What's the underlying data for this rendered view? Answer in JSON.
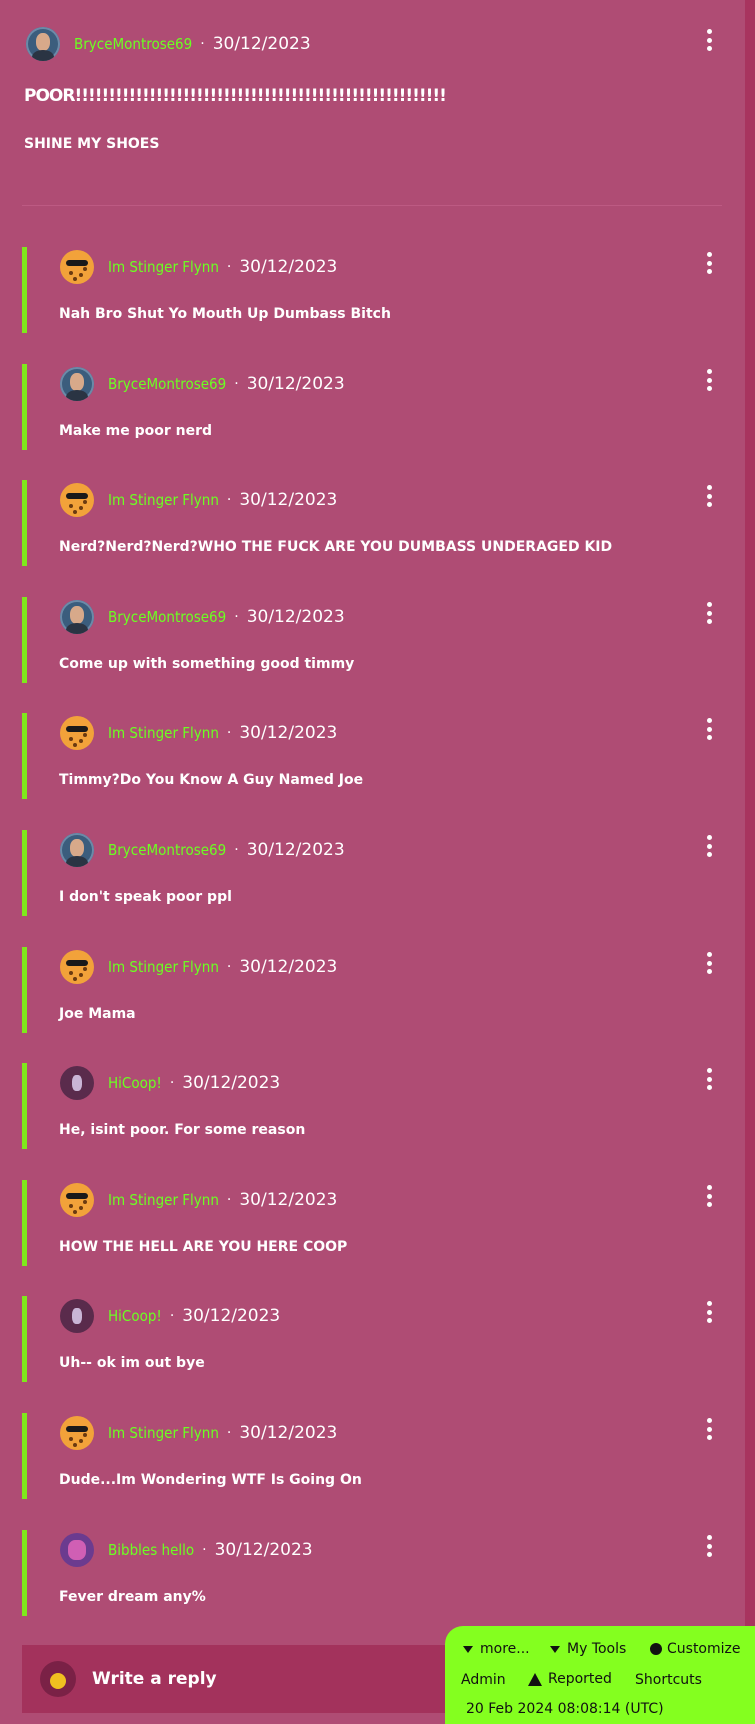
{
  "post": {
    "author": "BryceMontrose69",
    "date": "30/12/2023",
    "title": "POOR!!!!!!!!!!!!!!!!!!!!!!!!!!!!!!!!!!!!!!!!!!!!!!!!!!!!!!!",
    "body": "SHINE MY SHOES"
  },
  "separator": "·",
  "replies": [
    {
      "author": "Im Stinger Flynn",
      "avatar": "flynn",
      "date": "30/12/2023",
      "text": "Nah Bro Shut Yo Mouth Up Dumbass Bitch"
    },
    {
      "author": "BryceMontrose69",
      "avatar": "bryce",
      "date": "30/12/2023",
      "text": "Make me poor nerd"
    },
    {
      "author": "Im Stinger Flynn",
      "avatar": "flynn",
      "date": "30/12/2023",
      "text": "Nerd?Nerd?Nerd?WHO THE FUCK ARE YOU DUMBASS UNDERAGED KID"
    },
    {
      "author": "BryceMontrose69",
      "avatar": "bryce",
      "date": "30/12/2023",
      "text": "Come up with something good timmy"
    },
    {
      "author": "Im Stinger Flynn",
      "avatar": "flynn",
      "date": "30/12/2023",
      "text": "Timmy?Do You Know A Guy Named Joe"
    },
    {
      "author": "BryceMontrose69",
      "avatar": "bryce",
      "date": "30/12/2023",
      "text": "I don't speak poor ppl"
    },
    {
      "author": "Im Stinger Flynn",
      "avatar": "flynn",
      "date": "30/12/2023",
      "text": "Joe Mama"
    },
    {
      "author": "HiCoop!",
      "avatar": "coop",
      "date": "30/12/2023",
      "text": "He, isint poor. For some reason"
    },
    {
      "author": "Im Stinger Flynn",
      "avatar": "flynn",
      "date": "30/12/2023",
      "text": "HOW THE HELL ARE YOU HERE COOP"
    },
    {
      "author": "HiCoop!",
      "avatar": "coop",
      "date": "30/12/2023",
      "text": "Uh-- ok im out bye"
    },
    {
      "author": "Im Stinger Flynn",
      "avatar": "flynn",
      "date": "30/12/2023",
      "text": "Dude...Im Wondering WTF Is Going On"
    },
    {
      "author": "Bibbles hello",
      "avatar": "bibbles",
      "date": "30/12/2023",
      "text": "Fever dream any%"
    }
  ],
  "reply_box": {
    "placeholder": "Write a reply"
  },
  "toolbar": {
    "more": "more...",
    "my_tools": "My Tools",
    "customize": "Customize",
    "admin": "Admin",
    "reported": "Reported",
    "shortcuts": "Shortcuts",
    "clock": "20 Feb 2024 08:08:14 (UTC)"
  },
  "colors": {
    "background": "#af4c74",
    "username": "#6bff22",
    "reply_bar": "#7fe81c",
    "toolbar": "#84ff1f"
  }
}
